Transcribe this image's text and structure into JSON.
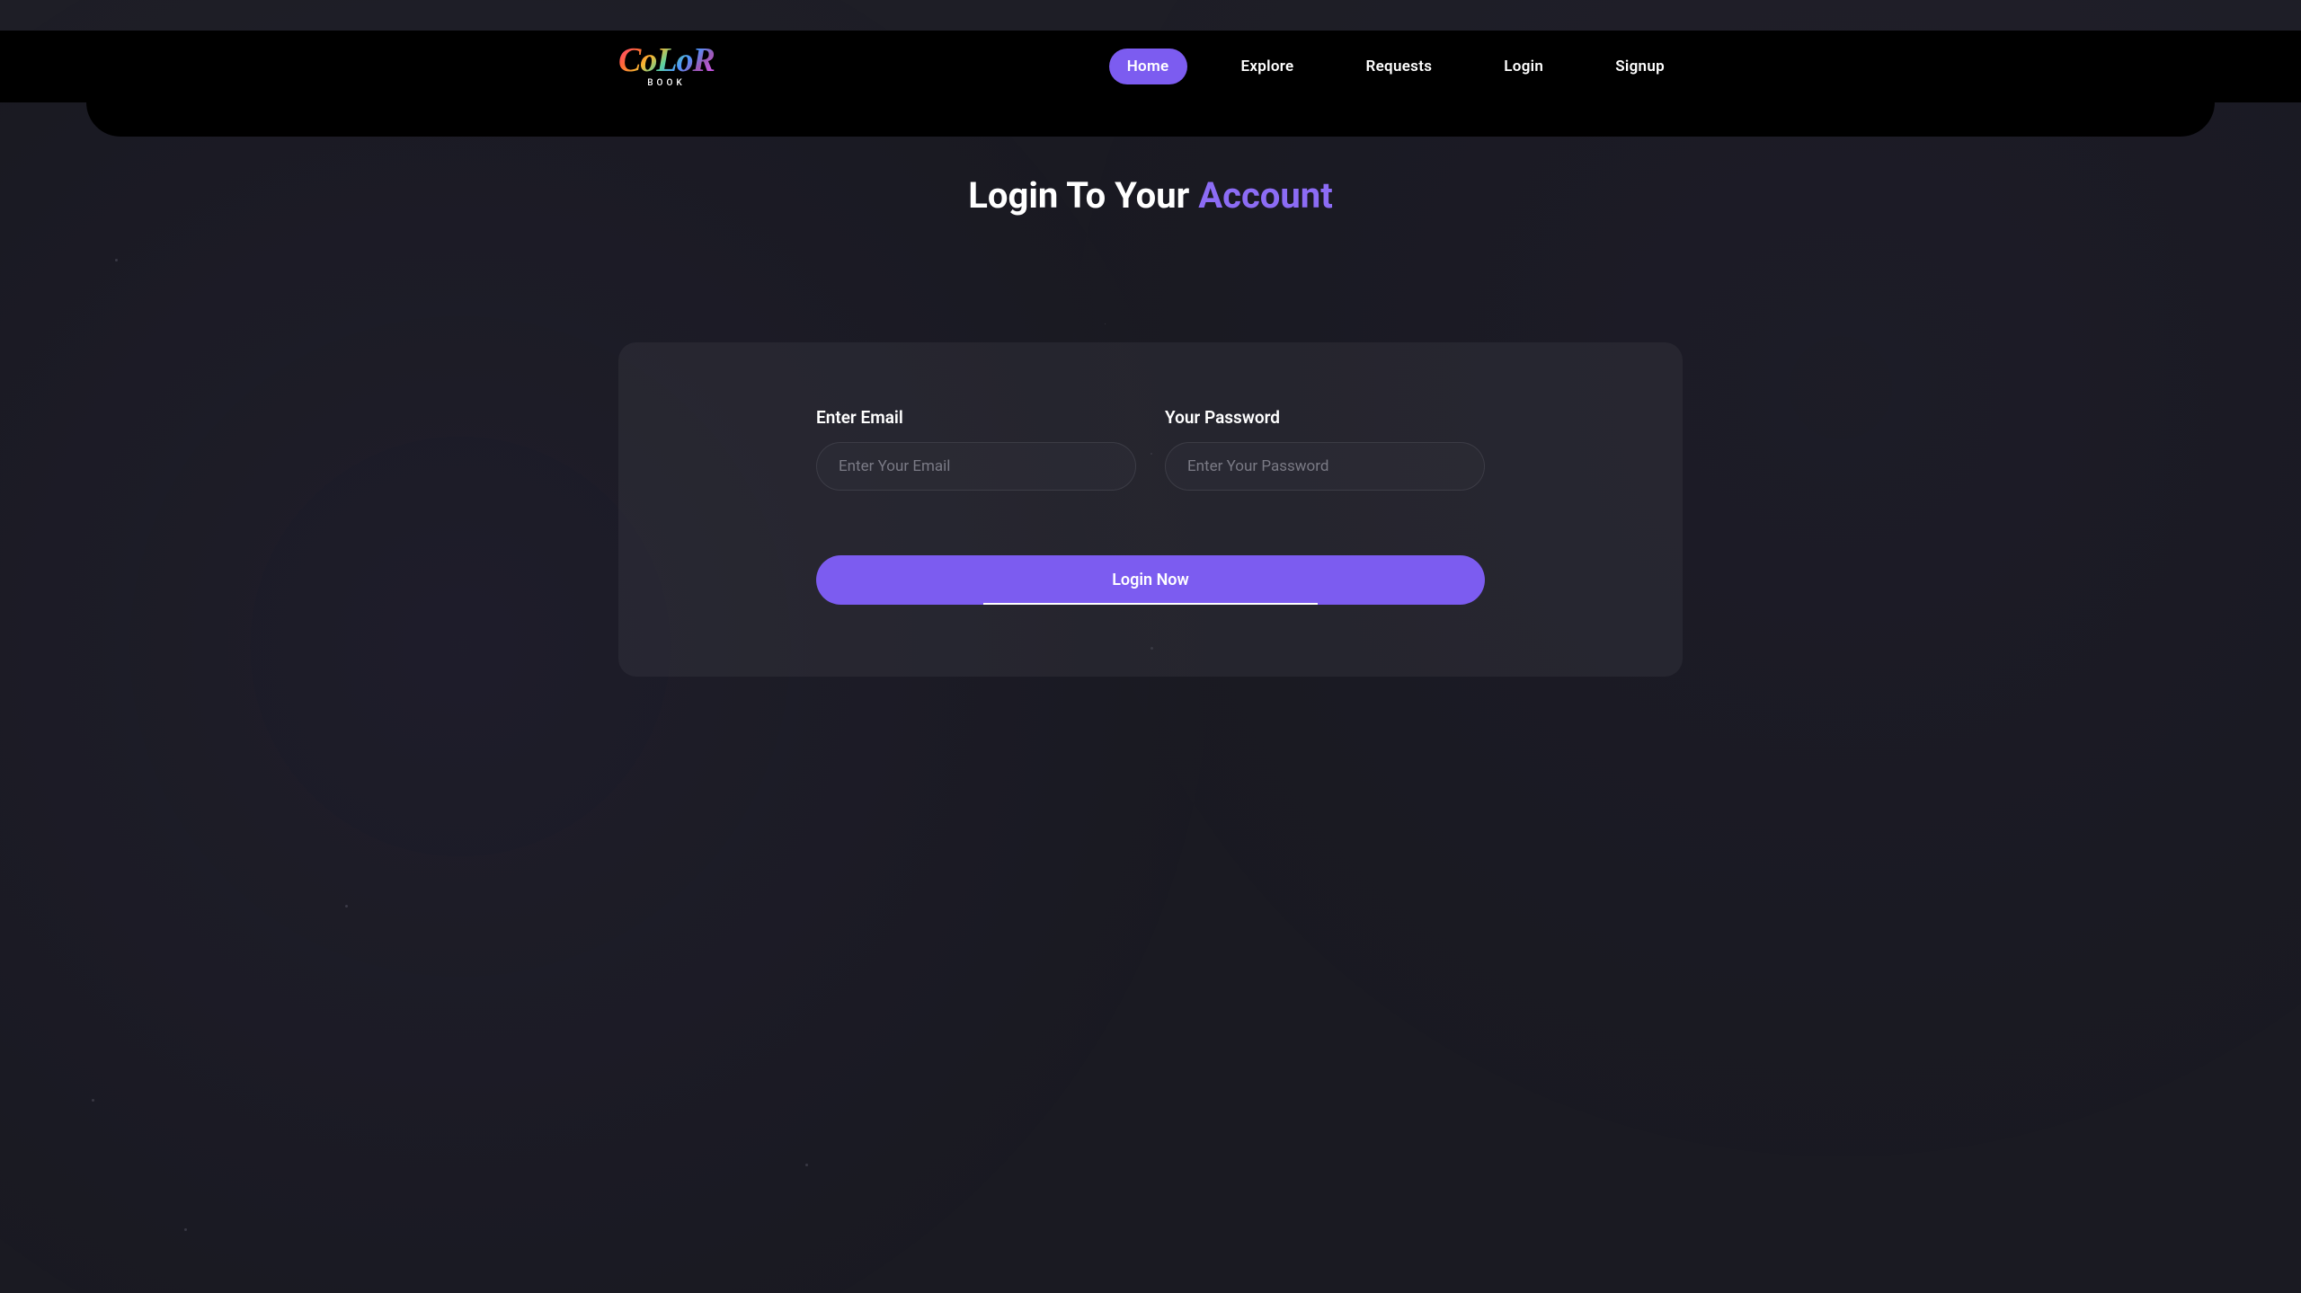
{
  "logo": {
    "title": "CoLoR",
    "subtitle": "BOOK"
  },
  "nav": {
    "items": [
      {
        "label": "Home",
        "active": true
      },
      {
        "label": "Explore",
        "active": false
      },
      {
        "label": "Requests",
        "active": false
      },
      {
        "label": "Login",
        "active": false
      },
      {
        "label": "Signup",
        "active": false
      }
    ]
  },
  "heading": {
    "prefix": "Login To Your ",
    "accent": "Account"
  },
  "form": {
    "email": {
      "label": "Enter Email",
      "placeholder": "Enter Your Email",
      "value": ""
    },
    "password": {
      "label": "Your Password",
      "placeholder": "Enter Your Password",
      "value": ""
    },
    "submit_label": "Login Now"
  },
  "colors": {
    "accent": "#7c5cf0",
    "background": "#1a1a22",
    "card": "rgba(60, 60, 70, 0.35)"
  }
}
